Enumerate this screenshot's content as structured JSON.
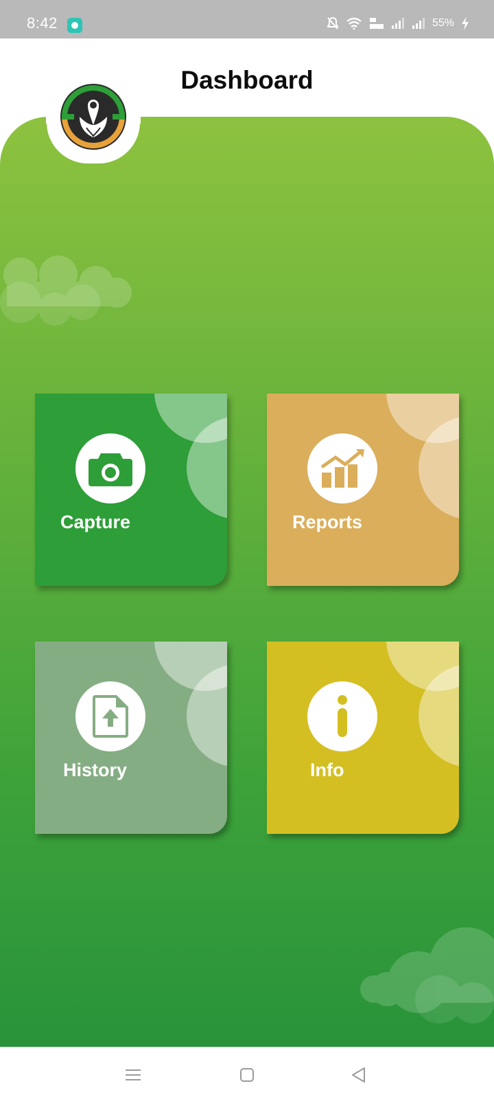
{
  "status_bar": {
    "time": "8:42",
    "battery": "55%",
    "icons": [
      "app-notification-icon",
      "mute-icon",
      "wifi-icon",
      "volte-icon",
      "signal-icon",
      "signal-icon",
      "charging-icon"
    ]
  },
  "header": {
    "title": "Dashboard"
  },
  "logo": {
    "icon": "hands-camera-logo",
    "colors": {
      "ring_top": "#2e9e38",
      "ring_bottom": "#e8a23a",
      "center": "#2a2a2a"
    }
  },
  "cards": [
    {
      "label": "Capture",
      "icon": "camera-icon",
      "color": "#2e9e38"
    },
    {
      "label": "Reports",
      "icon": "chart-icon",
      "color": "#dbae5c"
    },
    {
      "label": "History",
      "icon": "file-upload-icon",
      "color": "#85ad83"
    },
    {
      "label": "Info",
      "icon": "info-icon",
      "color": "#d4bf23"
    }
  ],
  "nav_bar": {
    "buttons": [
      "menu-icon",
      "home-icon",
      "back-icon"
    ]
  },
  "colors": {
    "panel_top": "#8dc23f",
    "panel_bottom": "#28933a"
  }
}
